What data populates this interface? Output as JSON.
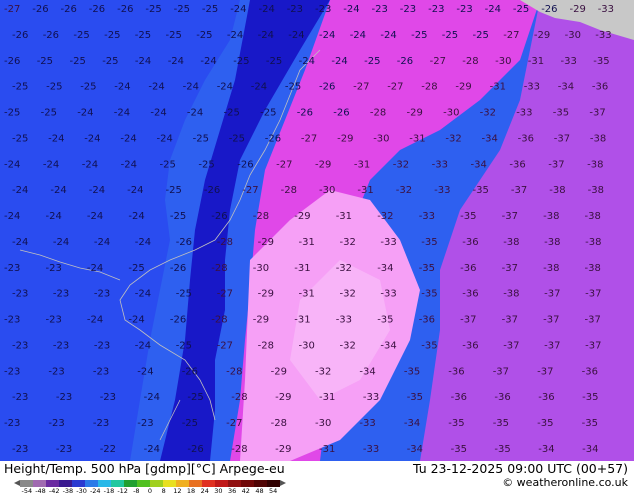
{
  "title": "Height/Temp. 500 hPa [gdmp][°C] Arpege-eu",
  "valid_time": "Tu 23-12-2025 09:00 UTC (00+57)",
  "credit": "© weatheronline.co.uk",
  "legend": {
    "ticks": [
      "-54",
      "-48",
      "-42",
      "-38",
      "-30",
      "-24",
      "-18",
      "-12",
      "-8",
      "0",
      "8",
      "12",
      "18",
      "24",
      "30",
      "36",
      "42",
      "48",
      "54"
    ],
    "colors": [
      "#8a8a8a",
      "#a06ab0",
      "#6a2aa0",
      "#3a1a90",
      "#2a3ad0",
      "#2a7ae8",
      "#28b8e8",
      "#20c8a0",
      "#20a030",
      "#50c020",
      "#a0d020",
      "#e8e020",
      "#f0b020",
      "#e87020",
      "#e03020",
      "#c01818",
      "#901010",
      "#700808",
      "#500404",
      "#300000"
    ]
  },
  "contours": {
    "palette": {
      "deep_blue": "#1a1ad0",
      "blue": "#2a52f0",
      "mid_blue": "#2e6cf0",
      "purple": "#b84ae8",
      "magenta": "#e040e8",
      "violet": "#c070f0",
      "light_pink": "#f6a0f6",
      "land": "#c8c8c8"
    },
    "rows": [
      [
        "27",
        "26",
        "26",
        "26",
        "26",
        "25",
        "25",
        "25",
        "24",
        "24",
        "23",
        "23",
        "24",
        "23",
        "23",
        "23",
        "23",
        "24",
        "25",
        "26",
        "29",
        "33"
      ],
      [
        "26",
        "26",
        "25",
        "25",
        "25",
        "25",
        "25",
        "24",
        "24",
        "24",
        "24",
        "24",
        "24",
        "25",
        "25",
        "25",
        "27",
        "29",
        "30",
        "33"
      ],
      [
        "26",
        "25",
        "25",
        "25",
        "24",
        "24",
        "24",
        "25",
        "25",
        "24",
        "24",
        "25",
        "26",
        "27",
        "28",
        "30",
        "31",
        "33",
        "35"
      ],
      [
        "25",
        "25",
        "25",
        "24",
        "24",
        "24",
        "24",
        "24",
        "25",
        "26",
        "27",
        "27",
        "28",
        "29",
        "31",
        "33",
        "34",
        "36"
      ],
      [
        "25",
        "25",
        "24",
        "24",
        "24",
        "24",
        "25",
        "25",
        "26",
        "26",
        "28",
        "29",
        "30",
        "32",
        "33",
        "35",
        "37"
      ],
      [
        "25",
        "24",
        "24",
        "24",
        "24",
        "25",
        "25",
        "26",
        "27",
        "29",
        "30",
        "31",
        "32",
        "34",
        "36",
        "37",
        "38"
      ],
      [
        "24",
        "24",
        "24",
        "24",
        "25",
        "25",
        "26",
        "27",
        "29",
        "31",
        "32",
        "33",
        "34",
        "36",
        "37",
        "38"
      ],
      [
        "24",
        "24",
        "24",
        "24",
        "25",
        "26",
        "27",
        "28",
        "30",
        "31",
        "32",
        "33",
        "35",
        "37",
        "38",
        "38"
      ],
      [
        "24",
        "24",
        "24",
        "24",
        "25",
        "26",
        "28",
        "29",
        "31",
        "32",
        "33",
        "35",
        "37",
        "38",
        "38"
      ],
      [
        "24",
        "24",
        "24",
        "24",
        "26",
        "28",
        "29",
        "31",
        "32",
        "33",
        "35",
        "36",
        "38",
        "38",
        "38"
      ],
      [
        "23",
        "23",
        "24",
        "25",
        "26",
        "28",
        "30",
        "31",
        "32",
        "34",
        "35",
        "36",
        "37",
        "38",
        "38"
      ],
      [
        "23",
        "23",
        "23",
        "24",
        "25",
        "27",
        "29",
        "31",
        "32",
        "33",
        "35",
        "36",
        "38",
        "37",
        "37"
      ],
      [
        "23",
        "23",
        "24",
        "24",
        "26",
        "28",
        "29",
        "31",
        "33",
        "35",
        "36",
        "37",
        "37",
        "37",
        "37"
      ],
      [
        "23",
        "23",
        "23",
        "24",
        "25",
        "27",
        "28",
        "30",
        "32",
        "34",
        "35",
        "36",
        "37",
        "37",
        "37"
      ],
      [
        "23",
        "23",
        "23",
        "24",
        "26",
        "28",
        "29",
        "32",
        "34",
        "35",
        "36",
        "37",
        "37",
        "36"
      ],
      [
        "23",
        "23",
        "23",
        "24",
        "25",
        "28",
        "29",
        "31",
        "33",
        "35",
        "36",
        "36",
        "36",
        "35"
      ],
      [
        "23",
        "23",
        "23",
        "23",
        "25",
        "27",
        "28",
        "30",
        "33",
        "34",
        "35",
        "35",
        "35",
        "35"
      ],
      [
        "23",
        "23",
        "22",
        "24",
        "26",
        "28",
        "29",
        "31",
        "33",
        "34",
        "35",
        "35",
        "34",
        "34"
      ]
    ]
  }
}
